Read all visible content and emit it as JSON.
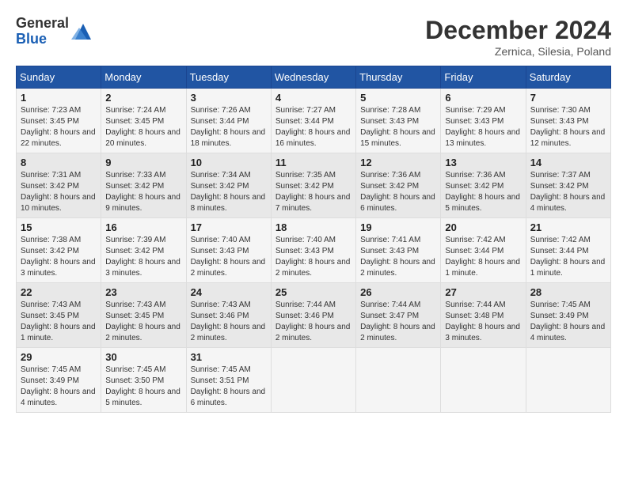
{
  "header": {
    "logo_line1": "General",
    "logo_line2": "Blue",
    "month": "December 2024",
    "location": "Zernica, Silesia, Poland"
  },
  "weekdays": [
    "Sunday",
    "Monday",
    "Tuesday",
    "Wednesday",
    "Thursday",
    "Friday",
    "Saturday"
  ],
  "weeks": [
    [
      {
        "day": "1",
        "sunrise": "7:23 AM",
        "sunset": "3:45 PM",
        "daylight": "8 hours and 22 minutes."
      },
      {
        "day": "2",
        "sunrise": "7:24 AM",
        "sunset": "3:45 PM",
        "daylight": "8 hours and 20 minutes."
      },
      {
        "day": "3",
        "sunrise": "7:26 AM",
        "sunset": "3:44 PM",
        "daylight": "8 hours and 18 minutes."
      },
      {
        "day": "4",
        "sunrise": "7:27 AM",
        "sunset": "3:44 PM",
        "daylight": "8 hours and 16 minutes."
      },
      {
        "day": "5",
        "sunrise": "7:28 AM",
        "sunset": "3:43 PM",
        "daylight": "8 hours and 15 minutes."
      },
      {
        "day": "6",
        "sunrise": "7:29 AM",
        "sunset": "3:43 PM",
        "daylight": "8 hours and 13 minutes."
      },
      {
        "day": "7",
        "sunrise": "7:30 AM",
        "sunset": "3:43 PM",
        "daylight": "8 hours and 12 minutes."
      }
    ],
    [
      {
        "day": "8",
        "sunrise": "7:31 AM",
        "sunset": "3:42 PM",
        "daylight": "8 hours and 10 minutes."
      },
      {
        "day": "9",
        "sunrise": "7:33 AM",
        "sunset": "3:42 PM",
        "daylight": "8 hours and 9 minutes."
      },
      {
        "day": "10",
        "sunrise": "7:34 AM",
        "sunset": "3:42 PM",
        "daylight": "8 hours and 8 minutes."
      },
      {
        "day": "11",
        "sunrise": "7:35 AM",
        "sunset": "3:42 PM",
        "daylight": "8 hours and 7 minutes."
      },
      {
        "day": "12",
        "sunrise": "7:36 AM",
        "sunset": "3:42 PM",
        "daylight": "8 hours and 6 minutes."
      },
      {
        "day": "13",
        "sunrise": "7:36 AM",
        "sunset": "3:42 PM",
        "daylight": "8 hours and 5 minutes."
      },
      {
        "day": "14",
        "sunrise": "7:37 AM",
        "sunset": "3:42 PM",
        "daylight": "8 hours and 4 minutes."
      }
    ],
    [
      {
        "day": "15",
        "sunrise": "7:38 AM",
        "sunset": "3:42 PM",
        "daylight": "8 hours and 3 minutes."
      },
      {
        "day": "16",
        "sunrise": "7:39 AM",
        "sunset": "3:42 PM",
        "daylight": "8 hours and 3 minutes."
      },
      {
        "day": "17",
        "sunrise": "7:40 AM",
        "sunset": "3:43 PM",
        "daylight": "8 hours and 2 minutes."
      },
      {
        "day": "18",
        "sunrise": "7:40 AM",
        "sunset": "3:43 PM",
        "daylight": "8 hours and 2 minutes."
      },
      {
        "day": "19",
        "sunrise": "7:41 AM",
        "sunset": "3:43 PM",
        "daylight": "8 hours and 2 minutes."
      },
      {
        "day": "20",
        "sunrise": "7:42 AM",
        "sunset": "3:44 PM",
        "daylight": "8 hours and 1 minute."
      },
      {
        "day": "21",
        "sunrise": "7:42 AM",
        "sunset": "3:44 PM",
        "daylight": "8 hours and 1 minute."
      }
    ],
    [
      {
        "day": "22",
        "sunrise": "7:43 AM",
        "sunset": "3:45 PM",
        "daylight": "8 hours and 1 minute."
      },
      {
        "day": "23",
        "sunrise": "7:43 AM",
        "sunset": "3:45 PM",
        "daylight": "8 hours and 2 minutes."
      },
      {
        "day": "24",
        "sunrise": "7:43 AM",
        "sunset": "3:46 PM",
        "daylight": "8 hours and 2 minutes."
      },
      {
        "day": "25",
        "sunrise": "7:44 AM",
        "sunset": "3:46 PM",
        "daylight": "8 hours and 2 minutes."
      },
      {
        "day": "26",
        "sunrise": "7:44 AM",
        "sunset": "3:47 PM",
        "daylight": "8 hours and 2 minutes."
      },
      {
        "day": "27",
        "sunrise": "7:44 AM",
        "sunset": "3:48 PM",
        "daylight": "8 hours and 3 minutes."
      },
      {
        "day": "28",
        "sunrise": "7:45 AM",
        "sunset": "3:49 PM",
        "daylight": "8 hours and 4 minutes."
      }
    ],
    [
      {
        "day": "29",
        "sunrise": "7:45 AM",
        "sunset": "3:49 PM",
        "daylight": "8 hours and 4 minutes."
      },
      {
        "day": "30",
        "sunrise": "7:45 AM",
        "sunset": "3:50 PM",
        "daylight": "8 hours and 5 minutes."
      },
      {
        "day": "31",
        "sunrise": "7:45 AM",
        "sunset": "3:51 PM",
        "daylight": "8 hours and 6 minutes."
      },
      null,
      null,
      null,
      null
    ]
  ]
}
